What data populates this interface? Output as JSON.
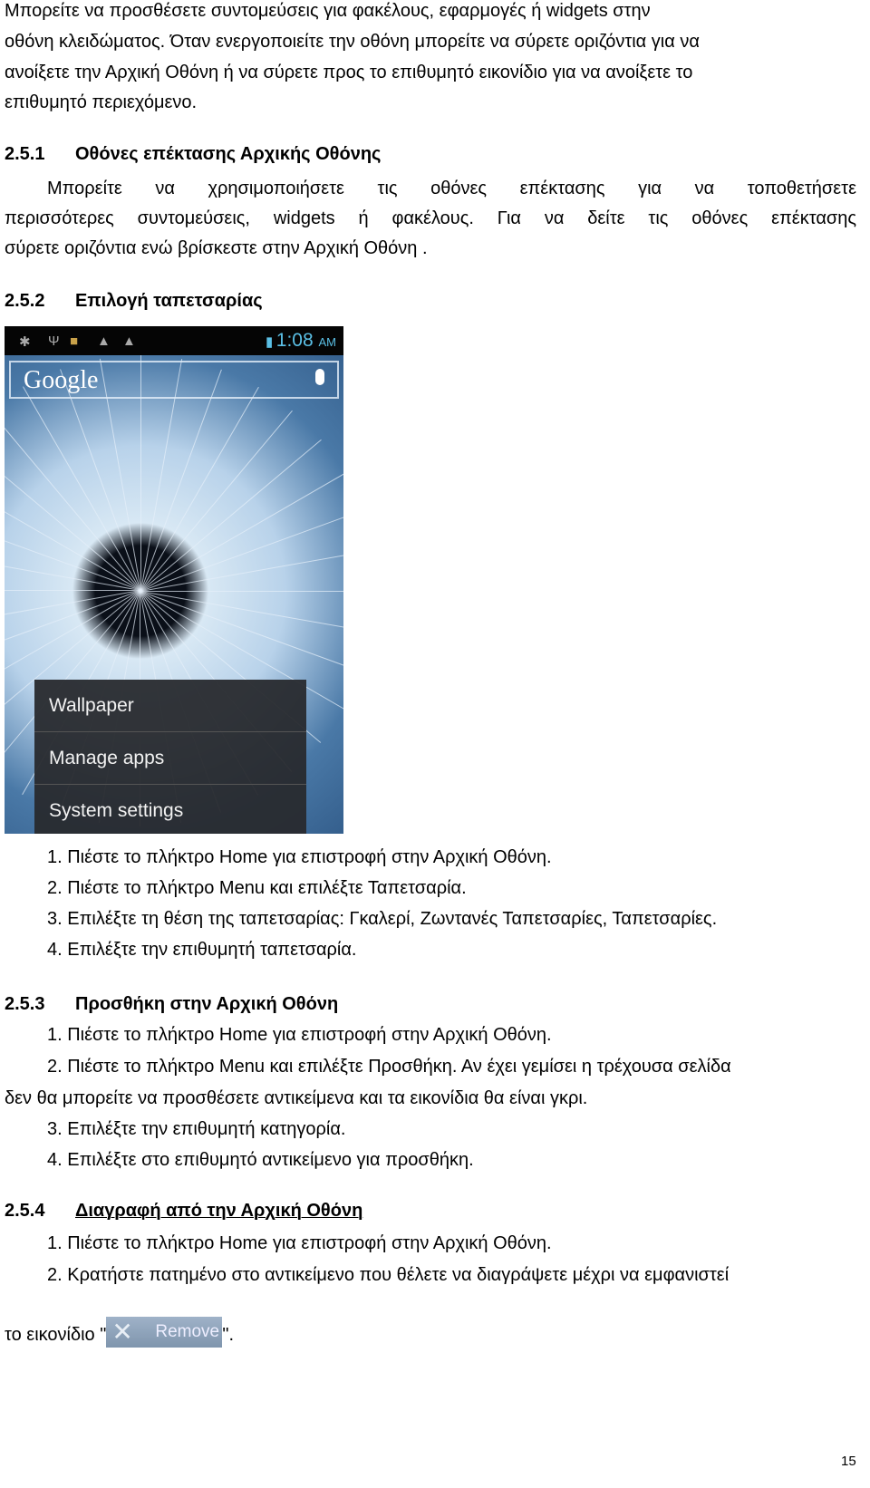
{
  "intro": [
    "Μπορείτε να προσθέσετε συντομεύσεις για φακέλους, εφαρμογές ή widgets στην",
    "οθόνη κλειδώματος. Όταν ενεργοποιείτε την οθόνη μπορείτε να σύρετε οριζόντια για να",
    "ανοίξετε την Αρχική Οθόνη ή να σύρετε προς το επιθυμητό εικονίδιο για να ανοίξετε το",
    "επιθυμητό περιεχόμενο."
  ],
  "s251": {
    "num": "2.5.1",
    "title": "Οθόνες επέκτασης Αρχικής Οθόνης",
    "lines": [
      "Μπορείτε να χρησιμοποιήσετε τις οθόνες επέκτασης για να τοποθετήσετε",
      "περισσότερες συντομεύσεις, widgets ή φακέλους. Για να δείτε τις οθόνες επέκτασης",
      "σύρετε οριζόντια ενώ βρίσκεστε στην Αρχική Οθόνη ."
    ]
  },
  "s252": {
    "num": "2.5.2",
    "title": "Επιλογή ταπετσαρίας",
    "phone": {
      "time": "1:08",
      "ampm": "AM",
      "search_logo": "Google",
      "menu": [
        "Wallpaper",
        "Manage apps",
        "System settings"
      ]
    },
    "steps": [
      "1. Πιέστε το πλήκτρο Home για επιστροφή στην Αρχική Οθόνη.",
      "2. Πιέστε το πλήκτρο Menu και επιλέξτε Ταπετσαρία.",
      "3. Επιλέξτε τη θέση της ταπετσαρίας: Γκαλερί, Ζωντανές Ταπετσαρίες, Ταπετσαρίες.",
      "4. Επιλέξτε την επιθυμητή ταπετσαρία."
    ]
  },
  "s253": {
    "num": "2.5.3",
    "title": "Προσθήκη στην Αρχική Οθόνη",
    "steps": [
      "1. Πιέστε το πλήκτρο Home για επιστροφή στην Αρχική Οθόνη.",
      "2. Πιέστε το πλήκτρο Menu και επιλέξτε Προσθήκη. Αν έχει γεμίσει η τρέχουσα σελίδα",
      "δεν θα μπορείτε να προσθέσετε αντικείμενα και τα εικονίδια θα είναι γκρι.",
      "3. Επιλέξτε την επιθυμητή κατηγορία.",
      "4. Επιλέξτε στο επιθυμητό αντικείμενο για προσθήκη."
    ]
  },
  "s254": {
    "num": "2.5.4",
    "title": "Διαγραφή από την Αρχική Οθόνη",
    "steps": [
      "1. Πιέστε το πλήκτρο Home για επιστροφή στην Αρχική Οθόνη.",
      "2. Κρατήστε πατημένο στο αντικείμενο που θέλετε να διαγράψετε μέχρι να εμφανιστεί"
    ],
    "last_pre": "το εικονίδιο \"",
    "remove_label": "Remove",
    "last_post": "\"."
  },
  "page_number": "15"
}
